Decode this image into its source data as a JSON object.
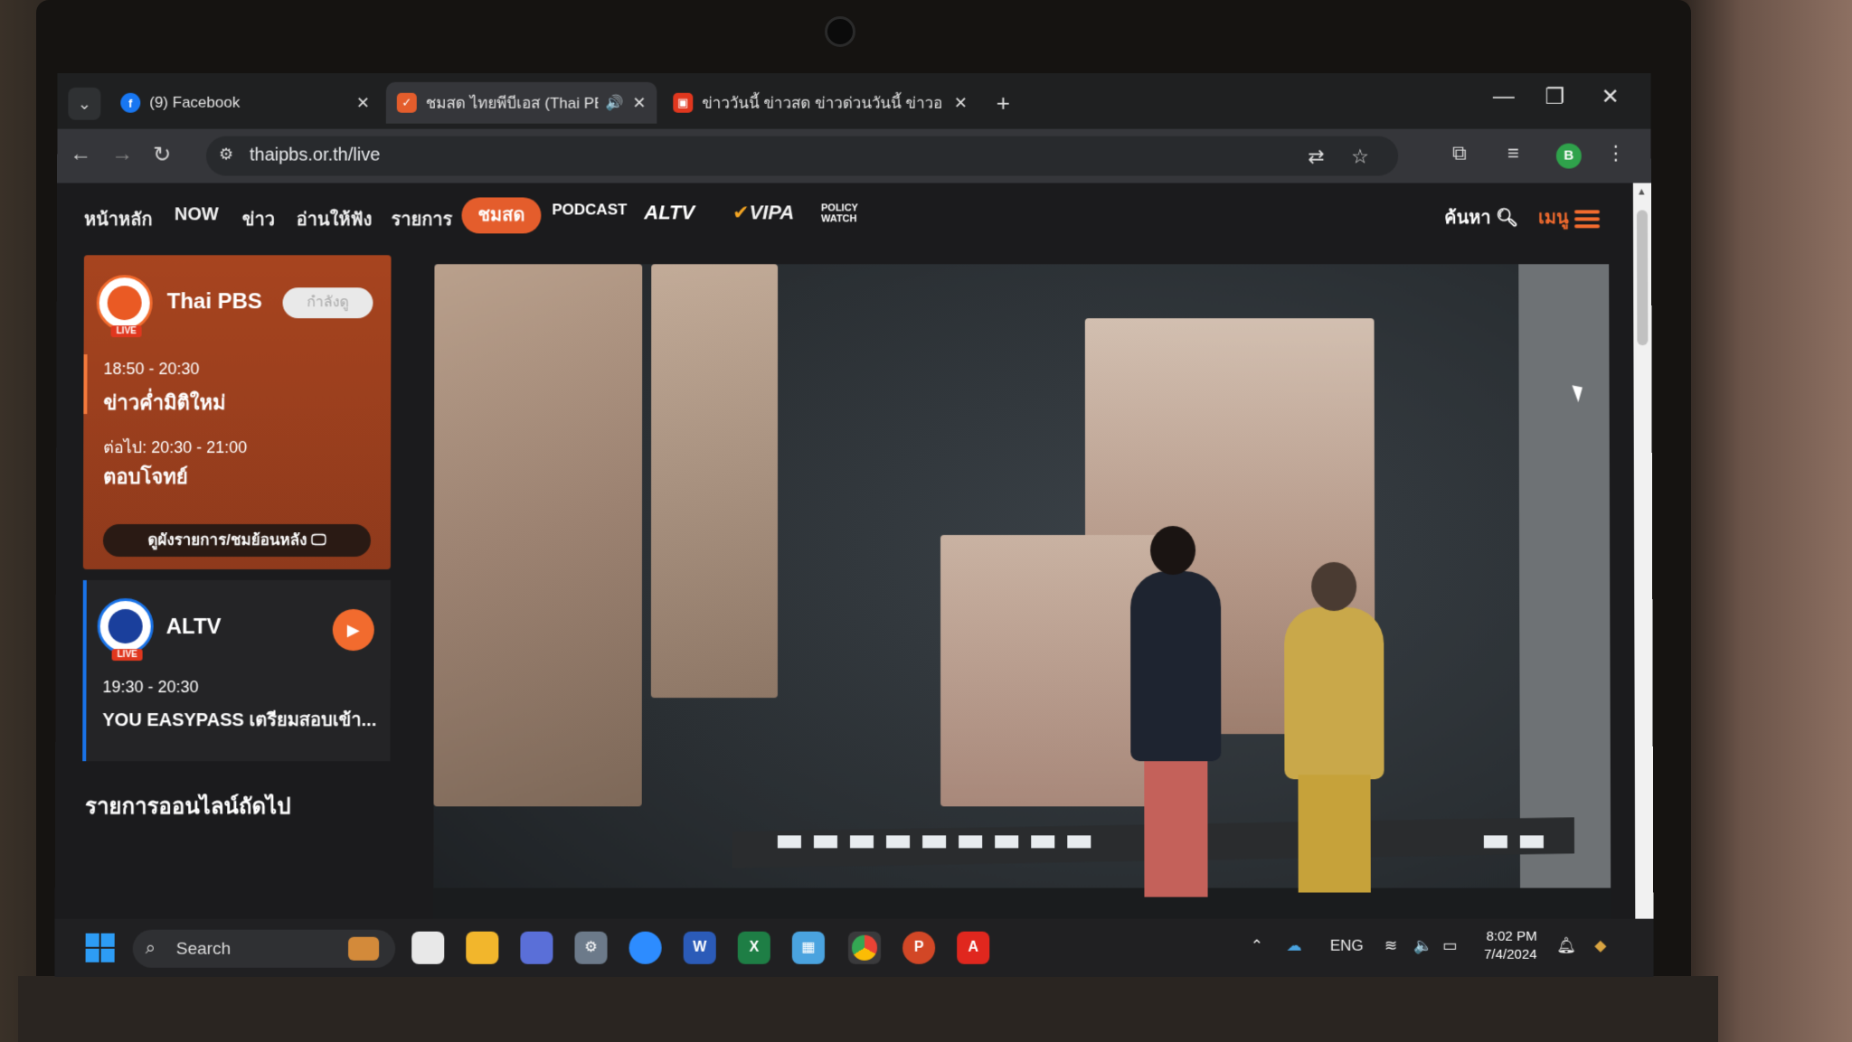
{
  "browser": {
    "tabs": [
      {
        "title": "(9) Facebook",
        "favicon": "facebook-icon",
        "active": false
      },
      {
        "title": "ชมสด ไทยพีบีเอส (Thai PBS Li",
        "favicon": "thaipbs-icon",
        "active": true,
        "audio": true
      },
      {
        "title": "ข่าววันนี้ ข่าวสด ข่าวด่วนวันนี้ ข่าวอ",
        "favicon": "news-icon",
        "active": false
      }
    ],
    "url": "thaipbs.or.th/live",
    "profile_initial": "B"
  },
  "site_nav": {
    "items": [
      "หน้าหลัก",
      "NOW",
      "ข่าว",
      "อ่านให้ฟัง",
      "รายการ"
    ],
    "live_label": "ชมสด",
    "brands": [
      "PODCAST",
      "ALTV",
      "VIPA",
      "POLICY WATCH"
    ],
    "search_label": "ค้นหา",
    "menu_label": "เมนู"
  },
  "channels": [
    {
      "name": "Thai PBS",
      "live_tag": "LIVE",
      "status_pill": "กำลังดู",
      "now_time": "18:50 - 20:30",
      "now_program": "ข่าวค่ำมิติใหม่",
      "next_time": "ต่อไป: 20:30 - 21:00",
      "next_program": "ตอบโจทย์",
      "guide_button": "ดูผังรายการ/ชมย้อนหลัง"
    },
    {
      "name": "ALTV",
      "live_tag": "LIVE",
      "now_time": "19:30 - 20:30",
      "now_program": "YOU EASYPASS เตรียมสอบเข้า..."
    }
  ],
  "upcoming_title": "รายการออนไลน์ถัดไป",
  "taskbar": {
    "search_placeholder": "Search",
    "language": "ENG",
    "time": "8:02 PM",
    "date": "7/4/2024"
  },
  "colors": {
    "accent_orange": "#f26b2e",
    "card_brown": "#9c3f1f",
    "live_red": "#e0371e"
  }
}
